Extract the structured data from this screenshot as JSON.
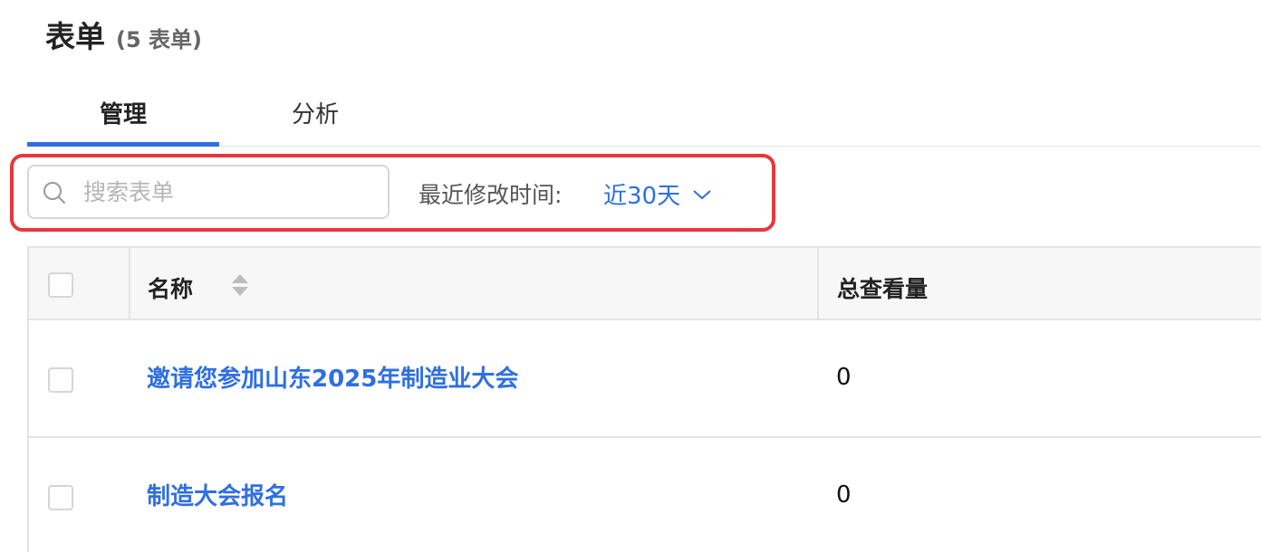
{
  "header": {
    "title": "表单",
    "count": "(5 表单)"
  },
  "tabs": [
    {
      "label": "管理",
      "active": true
    },
    {
      "label": "分析",
      "active": false
    }
  ],
  "search": {
    "placeholder": "搜索表单",
    "value": ""
  },
  "filter": {
    "label": "最近修改时间:",
    "value": "近30天"
  },
  "table": {
    "columns": [
      "名称",
      "总查看量"
    ],
    "rows": [
      {
        "name": "邀请您参加山东2025年制造业大会",
        "views": "0"
      },
      {
        "name": "制造大会报名",
        "views": "0"
      }
    ]
  },
  "colors": {
    "accent": "#2f6fe0",
    "highlight": "#e8373a"
  },
  "icons": [
    "search-icon",
    "chevron-down-icon",
    "sort-icon"
  ]
}
